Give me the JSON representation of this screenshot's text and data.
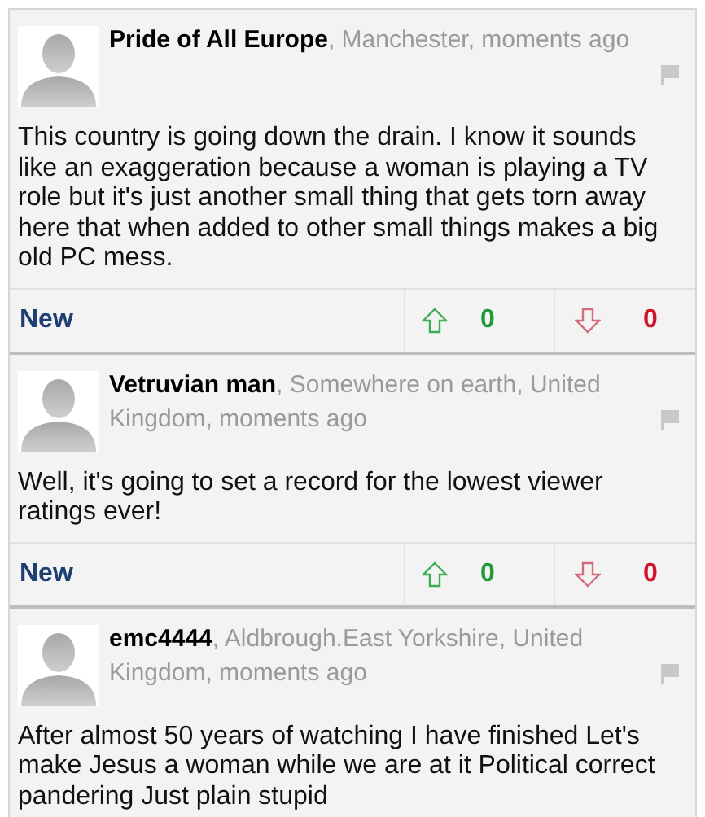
{
  "comments": [
    {
      "author": "Pride of All Europe",
      "meta": ", Manchester, moments ago",
      "body": "This country is going down the drain. I know it sounds like an exaggeration because a woman is playing a TV role but it's just another small thing that gets torn away here that when added to other small things makes a big old PC mess.",
      "status": "New",
      "up_count": "0",
      "down_count": "0"
    },
    {
      "author": "Vetruvian man",
      "meta": ", Somewhere on earth, United Kingdom, moments ago",
      "body": "Well, it's going to set a record for the lowest viewer ratings ever!",
      "status": "New",
      "up_count": "0",
      "down_count": "0"
    },
    {
      "author": "emc4444",
      "meta": ", Aldbrough.East Yorkshire, United Kingdom, moments ago",
      "body": "After almost 50 years of watching I have finished Let's make Jesus a woman while we are at it Political correct pandering Just plain stupid"
    }
  ]
}
